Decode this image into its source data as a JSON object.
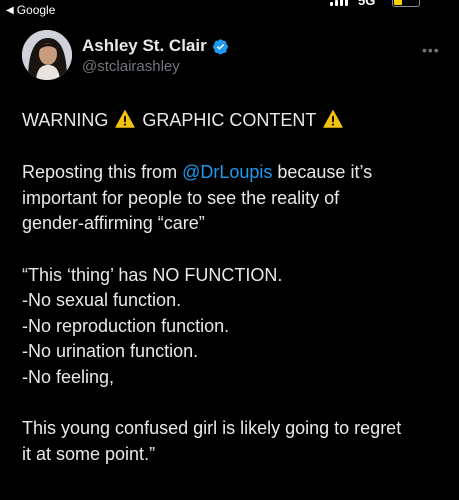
{
  "status_bar": {
    "back_label": "Google",
    "network": "5G"
  },
  "author": {
    "name": "Ashley St. Clair",
    "handle": "@stclairashley",
    "verified": true
  },
  "post": {
    "warning_left": "WARNING",
    "warning_mid": "GRAPHIC CONTENT",
    "line_repost_before": "Reposting this from ",
    "mention": "@DrLoupis",
    "line_repost_after": " because it’s",
    "line2": "important for people to see the reality of",
    "line3": "gender-affirming “care”",
    "quote1": "“This ‘thing’ has NO FUNCTION.",
    "quote2": "-No sexual function.",
    "quote3": "-No reproduction function.",
    "quote4": "-No urination function.",
    "quote5": "-No feeling,",
    "quote6": "This young confused girl is likely going to regret",
    "quote7": "it at some point.”"
  },
  "colors": {
    "background": "#000000",
    "text": "#e7e9ea",
    "secondary": "#71767b",
    "link": "#1d9bf0",
    "verified": "#1d9bf0",
    "warning": "#f4c20d"
  },
  "icons": [
    "back-arrow-icon",
    "signal-icon",
    "battery-icon",
    "verified-badge-icon",
    "more-options-icon",
    "warning-icon"
  ]
}
